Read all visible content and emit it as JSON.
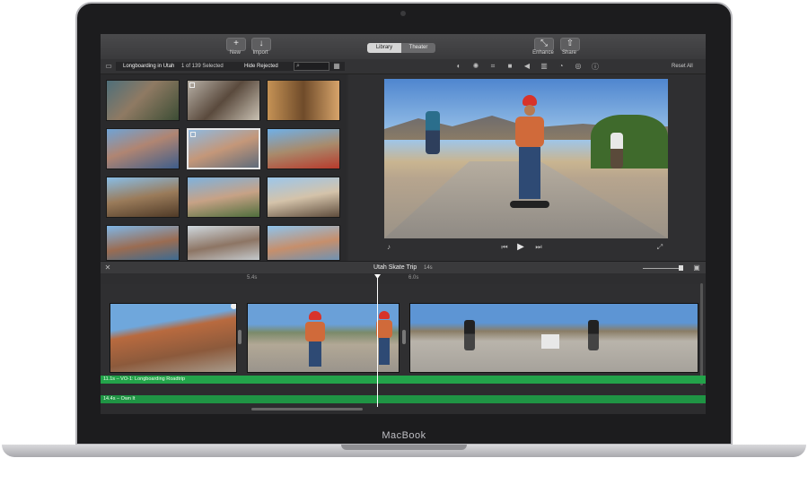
{
  "toolbar": {
    "new_label": "New",
    "import_label": "Import",
    "tabs": [
      "Library",
      "Theater"
    ],
    "enhance_label": "Enhance",
    "share_label": "Share"
  },
  "browser": {
    "event_name": "Longboarding in Utah",
    "selection_count": "1 of 139 Selected",
    "filter_label": "Hide Rejected"
  },
  "viewer": {
    "reset_label": "Reset All"
  },
  "timeline": {
    "project_title": "Utah Skate Trip",
    "project_duration": "14s",
    "ruler_marks": [
      "5.4s",
      "6.0s"
    ],
    "audio_tracks": [
      "11.1s – VO-1: Longboarding Roadtrip",
      "14.4s – Own It"
    ]
  },
  "device": {
    "brand": "MacBook"
  },
  "colors": {
    "accent_green": "#23a34a",
    "screen_bg": "#2c2c2e",
    "playhead": "#ffffff"
  }
}
